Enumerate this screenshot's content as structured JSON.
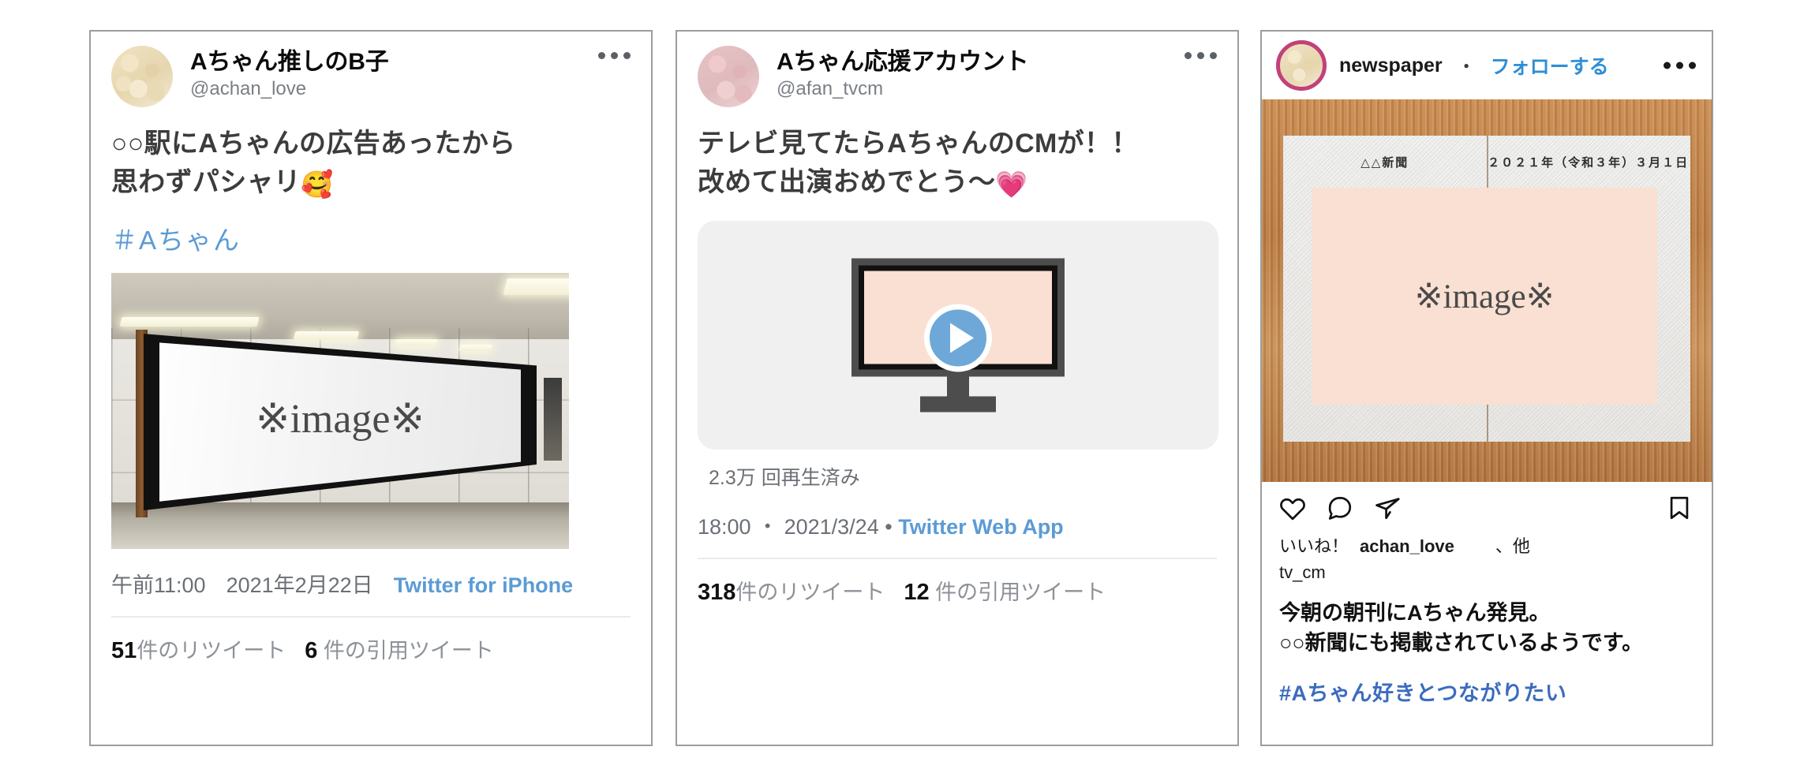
{
  "cards": [
    {
      "type": "tweet",
      "avatar_color": "#e6d6ae",
      "display_name": "Aちゃん推しのB子",
      "handle": "@achan_love",
      "body_line1": "○○駅にAちゃんの広告あったから",
      "body_line2": "思わずパシャリ",
      "body_emoji": "🥰",
      "hashtag": "＃Aちゃん",
      "media": {
        "kind": "photo",
        "alt": "station-billboard-photo",
        "placeholder_text": "※image※"
      },
      "time": "午前11:00",
      "date": "2021年2月22日",
      "source": "Twitter for iPhone",
      "retweet_count": "51",
      "retweet_label": "件のリツイート",
      "quote_count": "6",
      "quote_label": "件の引用ツイート"
    },
    {
      "type": "tweet",
      "avatar_color": "#debabd",
      "display_name": "Aちゃん応援アカウント",
      "handle": "@afan_tvcm",
      "body_line1": "テレビ見てたらAちゃんのCMが！！",
      "body_line2": "改めて出演おめでとう〜",
      "body_emoji": "💗",
      "media": {
        "kind": "video",
        "alt": "tv-video-thumbnail",
        "play_icon": "play-icon"
      },
      "views": "2.3万 回再生済み",
      "time": "18:00",
      "date": "2021/3/24",
      "source": "Twitter Web App",
      "retweet_count": "318",
      "retweet_label": "件のリツイート",
      "quote_count": "12",
      "quote_label": "件の引用ツイート"
    },
    {
      "type": "instagram",
      "username": "newspaper",
      "separator": "・",
      "follow_label": "フォローする",
      "media": {
        "kind": "newspaper",
        "alt": "newspaper-on-wood-table",
        "paper_title": "△△新聞",
        "paper_date": "２０２１年（令和３年）３月１日",
        "placeholder_text": "※image※"
      },
      "actions": {
        "like": "heart-icon",
        "comment": "comment-icon",
        "share": "share-icon",
        "save": "bookmark-icon"
      },
      "likes_prefix": "いいね！",
      "likes_user": "achan_love",
      "likes_suffix": "、他",
      "likes_user2": "tv_cm",
      "caption_line1": "今朝の朝刊にAちゃん発見。",
      "caption_line2": "○○新聞にも掲載されているようです。",
      "hashtag": "#Aちゃん好きとつながりたい"
    }
  ],
  "colors": {
    "link_blue": "#5b9bd5",
    "ig_link_blue": "#2f8ed6",
    "ig_tag_blue": "#3b6cbf",
    "card_border": "#9d9d9d",
    "muted_text": "#6b7076",
    "body_text": "#3c3c3c"
  }
}
